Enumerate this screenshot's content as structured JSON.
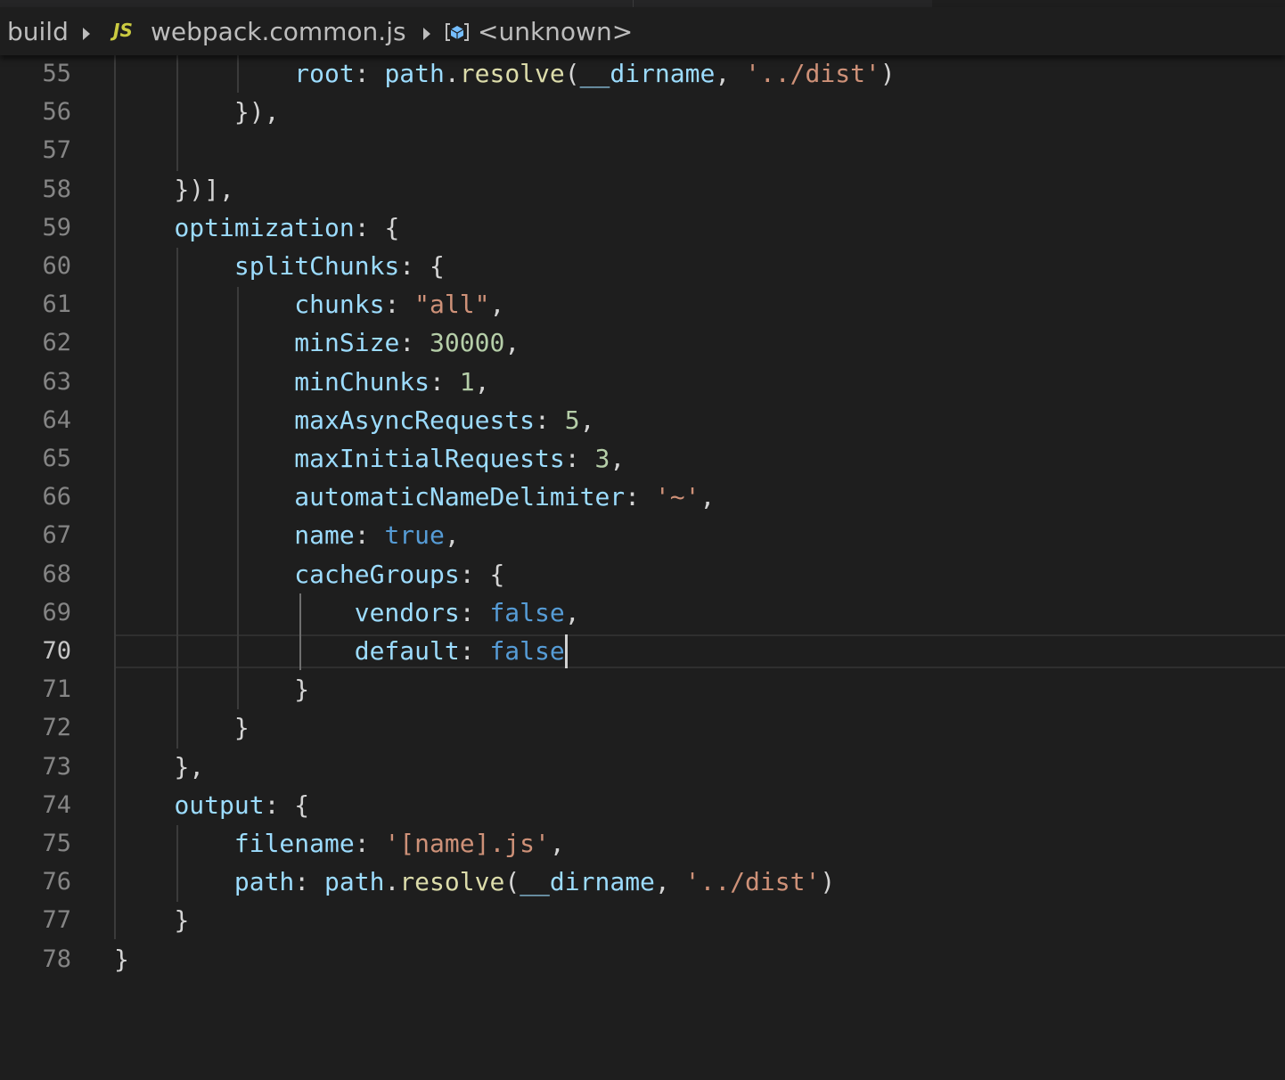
{
  "breadcrumbs": {
    "folder": "build",
    "file_icon": "JS",
    "file": "webpack.common.js",
    "symbol_icon": "symbol-namespace-icon",
    "symbol": "<unknown>"
  },
  "editor": {
    "active_line": "70",
    "colors": {
      "background": "#1e1e1e",
      "property": "#9cdcfe",
      "function": "#dcdcaa",
      "string": "#ce9178",
      "number": "#b5cea8",
      "keyword": "#569cd6",
      "punctuation": "#d4d4d4"
    },
    "lines": [
      {
        "num": "55",
        "tokens": [
          {
            "t": "            ",
            "c": "p"
          },
          {
            "t": "root",
            "c": "k"
          },
          {
            "t": ": ",
            "c": "p"
          },
          {
            "t": "path",
            "c": "k"
          },
          {
            "t": ".",
            "c": "p"
          },
          {
            "t": "resolve",
            "c": "fn"
          },
          {
            "t": "(",
            "c": "p"
          },
          {
            "t": "__dirname",
            "c": "k"
          },
          {
            "t": ", ",
            "c": "p"
          },
          {
            "t": "'../dist'",
            "c": "s"
          },
          {
            "t": ")",
            "c": "p"
          }
        ]
      },
      {
        "num": "56",
        "tokens": [
          {
            "t": "        ",
            "c": "p"
          },
          {
            "t": "}),",
            "c": "p"
          }
        ]
      },
      {
        "num": "57",
        "tokens": []
      },
      {
        "num": "58",
        "tokens": [
          {
            "t": "    ",
            "c": "p"
          },
          {
            "t": "})],",
            "c": "p"
          }
        ]
      },
      {
        "num": "59",
        "tokens": [
          {
            "t": "    ",
            "c": "p"
          },
          {
            "t": "optimization",
            "c": "k"
          },
          {
            "t": ": {",
            "c": "p"
          }
        ]
      },
      {
        "num": "60",
        "tokens": [
          {
            "t": "        ",
            "c": "p"
          },
          {
            "t": "splitChunks",
            "c": "k"
          },
          {
            "t": ": {",
            "c": "p"
          }
        ]
      },
      {
        "num": "61",
        "tokens": [
          {
            "t": "            ",
            "c": "p"
          },
          {
            "t": "chunks",
            "c": "k"
          },
          {
            "t": ": ",
            "c": "p"
          },
          {
            "t": "\"all\"",
            "c": "s"
          },
          {
            "t": ",",
            "c": "p"
          }
        ]
      },
      {
        "num": "62",
        "tokens": [
          {
            "t": "            ",
            "c": "p"
          },
          {
            "t": "minSize",
            "c": "k"
          },
          {
            "t": ": ",
            "c": "p"
          },
          {
            "t": "30000",
            "c": "n"
          },
          {
            "t": ",",
            "c": "p"
          }
        ]
      },
      {
        "num": "63",
        "tokens": [
          {
            "t": "            ",
            "c": "p"
          },
          {
            "t": "minChunks",
            "c": "k"
          },
          {
            "t": ": ",
            "c": "p"
          },
          {
            "t": "1",
            "c": "n"
          },
          {
            "t": ",",
            "c": "p"
          }
        ]
      },
      {
        "num": "64",
        "tokens": [
          {
            "t": "            ",
            "c": "p"
          },
          {
            "t": "maxAsyncRequests",
            "c": "k"
          },
          {
            "t": ": ",
            "c": "p"
          },
          {
            "t": "5",
            "c": "n"
          },
          {
            "t": ",",
            "c": "p"
          }
        ]
      },
      {
        "num": "65",
        "tokens": [
          {
            "t": "            ",
            "c": "p"
          },
          {
            "t": "maxInitialRequests",
            "c": "k"
          },
          {
            "t": ": ",
            "c": "p"
          },
          {
            "t": "3",
            "c": "n"
          },
          {
            "t": ",",
            "c": "p"
          }
        ]
      },
      {
        "num": "66",
        "tokens": [
          {
            "t": "            ",
            "c": "p"
          },
          {
            "t": "automaticNameDelimiter",
            "c": "k"
          },
          {
            "t": ": ",
            "c": "p"
          },
          {
            "t": "'~'",
            "c": "s"
          },
          {
            "t": ",",
            "c": "p"
          }
        ]
      },
      {
        "num": "67",
        "tokens": [
          {
            "t": "            ",
            "c": "p"
          },
          {
            "t": "name",
            "c": "k"
          },
          {
            "t": ": ",
            "c": "p"
          },
          {
            "t": "true",
            "c": "b"
          },
          {
            "t": ",",
            "c": "p"
          }
        ]
      },
      {
        "num": "68",
        "tokens": [
          {
            "t": "            ",
            "c": "p"
          },
          {
            "t": "cacheGroups",
            "c": "k"
          },
          {
            "t": ": {",
            "c": "p"
          }
        ]
      },
      {
        "num": "69",
        "tokens": [
          {
            "t": "                ",
            "c": "p"
          },
          {
            "t": "vendors",
            "c": "k"
          },
          {
            "t": ": ",
            "c": "p"
          },
          {
            "t": "false",
            "c": "b"
          },
          {
            "t": ",",
            "c": "p"
          }
        ]
      },
      {
        "num": "70",
        "tokens": [
          {
            "t": "                ",
            "c": "p"
          },
          {
            "t": "default",
            "c": "k"
          },
          {
            "t": ": ",
            "c": "p"
          },
          {
            "t": "false",
            "c": "b"
          }
        ]
      },
      {
        "num": "71",
        "tokens": [
          {
            "t": "            ",
            "c": "p"
          },
          {
            "t": "}",
            "c": "p"
          }
        ]
      },
      {
        "num": "72",
        "tokens": [
          {
            "t": "        ",
            "c": "p"
          },
          {
            "t": "}",
            "c": "p"
          }
        ]
      },
      {
        "num": "73",
        "tokens": [
          {
            "t": "    ",
            "c": "p"
          },
          {
            "t": "},",
            "c": "p"
          }
        ]
      },
      {
        "num": "74",
        "tokens": [
          {
            "t": "    ",
            "c": "p"
          },
          {
            "t": "output",
            "c": "k"
          },
          {
            "t": ": {",
            "c": "p"
          }
        ]
      },
      {
        "num": "75",
        "tokens": [
          {
            "t": "        ",
            "c": "p"
          },
          {
            "t": "filename",
            "c": "k"
          },
          {
            "t": ": ",
            "c": "p"
          },
          {
            "t": "'[name].js'",
            "c": "s"
          },
          {
            "t": ",",
            "c": "p"
          }
        ]
      },
      {
        "num": "76",
        "tokens": [
          {
            "t": "        ",
            "c": "p"
          },
          {
            "t": "path",
            "c": "k"
          },
          {
            "t": ": ",
            "c": "p"
          },
          {
            "t": "path",
            "c": "k"
          },
          {
            "t": ".",
            "c": "p"
          },
          {
            "t": "resolve",
            "c": "fn"
          },
          {
            "t": "(",
            "c": "p"
          },
          {
            "t": "__dirname",
            "c": "k"
          },
          {
            "t": ", ",
            "c": "p"
          },
          {
            "t": "'../dist'",
            "c": "s"
          },
          {
            "t": ")",
            "c": "p"
          }
        ]
      },
      {
        "num": "77",
        "tokens": [
          {
            "t": "    ",
            "c": "p"
          },
          {
            "t": "}",
            "c": "p"
          }
        ]
      },
      {
        "num": "78",
        "tokens": [
          {
            "t": "}",
            "c": "p"
          }
        ]
      }
    ]
  }
}
